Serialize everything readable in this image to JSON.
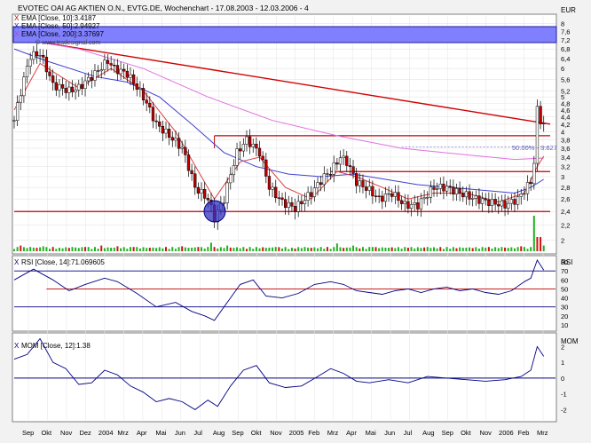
{
  "header": {
    "title": "EVOTEC OAI AG AKTIEN O.N., EVTG.DE, Wochenchart - 17.08.2003 - 12.03.2006 - 4",
    "currency": "EUR"
  },
  "legend": {
    "ema10": "EMA [Close, 10]:3.4187",
    "ema50": "EMA [Close, 50]:2.94927",
    "ema200": "EMA [Close, 200]:3.37697",
    "watermark": "© www.tradesignal.com"
  },
  "annotations": {
    "fib": "50.00% - 3.627"
  },
  "rsi_panel": {
    "label": "RSI [Close, 14]:71.069605",
    "unit": "RSI"
  },
  "mom_panel": {
    "label": "MOM [Close, 12]:1.38",
    "unit": "MOM"
  },
  "colors": {
    "up_candle": "#ffffff",
    "down_candle": "#c00000",
    "ema10": "#d84040",
    "ema50": "#4040d0",
    "ema200": "#e070e0",
    "trendline": "#d00000",
    "level": "#c00000",
    "volume_up": "#20b020",
    "volume_down": "#d01010",
    "indicator": "#000080",
    "legend_box": "#8080ff"
  },
  "chart_data": [
    {
      "type": "candlestick",
      "title": "EVOTEC OAI AG AKTIEN O.N., EVTG.DE, Wochenchart - 17.08.2003 - 12.03.2006 - 4",
      "ylabel": "EUR",
      "yscale": "log",
      "ylim": [
        1.85,
        8.4
      ],
      "yticks": [
        2,
        2.2,
        2.4,
        2.6,
        2.8,
        3,
        3.2,
        3.4,
        3.6,
        3.8,
        4,
        4.2,
        4.4,
        4.6,
        4.8,
        5,
        5.2,
        5.6,
        6,
        6.4,
        6.8,
        7.2,
        7.6,
        8
      ],
      "xticks": [
        "Sep",
        "Okt",
        "Nov",
        "Dez",
        "2004",
        "Mrz",
        "Apr",
        "Mai",
        "Jun",
        "Jul",
        "Aug",
        "Sep",
        "Okt",
        "Nov",
        "2005",
        "Feb",
        "Mrz",
        "Apr",
        "Mai",
        "Jun",
        "Jul",
        "Aug",
        "Sep",
        "Okt",
        "Nov",
        "2006",
        "Feb",
        "Mrz"
      ],
      "close_anchors": [
        [
          0,
          4.3
        ],
        [
          3,
          5.6
        ],
        [
          5,
          6.5
        ],
        [
          8,
          6.6
        ],
        [
          12,
          5.4
        ],
        [
          17,
          5.2
        ],
        [
          20,
          5.3
        ],
        [
          25,
          5.8
        ],
        [
          29,
          6.3
        ],
        [
          31,
          6.0
        ],
        [
          35,
          5.8
        ],
        [
          40,
          5.0
        ],
        [
          44,
          4.2
        ],
        [
          48,
          3.9
        ],
        [
          52,
          3.6
        ],
        [
          56,
          2.8
        ],
        [
          60,
          2.6
        ],
        [
          62,
          2.3
        ],
        [
          65,
          2.6
        ],
        [
          69,
          3.5
        ],
        [
          72,
          3.8
        ],
        [
          76,
          3.5
        ],
        [
          79,
          2.8
        ],
        [
          83,
          2.55
        ],
        [
          87,
          2.45
        ],
        [
          92,
          2.7
        ],
        [
          96,
          3.0
        ],
        [
          98,
          3.1
        ],
        [
          101,
          3.4
        ],
        [
          103,
          3.3
        ],
        [
          106,
          2.9
        ],
        [
          110,
          2.75
        ],
        [
          113,
          2.6
        ],
        [
          117,
          2.7
        ],
        [
          121,
          2.5
        ],
        [
          125,
          2.5
        ],
        [
          130,
          2.8
        ],
        [
          134,
          2.8
        ],
        [
          138,
          2.7
        ],
        [
          143,
          2.6
        ],
        [
          147,
          2.55
        ],
        [
          152,
          2.5
        ],
        [
          156,
          2.6
        ],
        [
          158,
          2.75
        ],
        [
          160,
          2.9
        ],
        [
          161,
          3.3
        ],
        [
          162,
          4.6
        ],
        [
          163,
          4.3
        ],
        [
          164,
          4.2
        ]
      ],
      "ema10": [
        [
          0,
          4.6
        ],
        [
          8,
          6.2
        ],
        [
          20,
          5.3
        ],
        [
          30,
          6.0
        ],
        [
          40,
          5.2
        ],
        [
          50,
          4.0
        ],
        [
          58,
          3.0
        ],
        [
          62,
          2.6
        ],
        [
          70,
          3.3
        ],
        [
          76,
          3.4
        ],
        [
          84,
          2.8
        ],
        [
          92,
          2.6
        ],
        [
          100,
          3.1
        ],
        [
          106,
          3.0
        ],
        [
          114,
          2.8
        ],
        [
          122,
          2.6
        ],
        [
          130,
          2.7
        ],
        [
          140,
          2.7
        ],
        [
          150,
          2.55
        ],
        [
          158,
          2.7
        ],
        [
          162,
          3.2
        ],
        [
          164,
          3.42
        ]
      ],
      "ema50": [
        [
          0,
          6.8
        ],
        [
          10,
          6.3
        ],
        [
          25,
          5.7
        ],
        [
          35,
          5.5
        ],
        [
          45,
          5.0
        ],
        [
          55,
          4.2
        ],
        [
          65,
          3.5
        ],
        [
          75,
          3.2
        ],
        [
          85,
          3.05
        ],
        [
          95,
          3.0
        ],
        [
          105,
          3.05
        ],
        [
          115,
          2.95
        ],
        [
          125,
          2.85
        ],
        [
          135,
          2.8
        ],
        [
          145,
          2.75
        ],
        [
          155,
          2.7
        ],
        [
          160,
          2.8
        ],
        [
          164,
          2.95
        ]
      ],
      "ema200": [
        [
          0,
          7.3
        ],
        [
          20,
          6.8
        ],
        [
          40,
          6.0
        ],
        [
          60,
          5.0
        ],
        [
          80,
          4.3
        ],
        [
          100,
          3.9
        ],
        [
          120,
          3.6
        ],
        [
          140,
          3.45
        ],
        [
          155,
          3.35
        ],
        [
          164,
          3.38
        ]
      ],
      "trendline": [
        [
          0,
          7.3
        ],
        [
          166,
          4.2
        ]
      ],
      "horizontal_levels": [
        {
          "y": 2.4,
          "from": 0,
          "to": 166
        },
        {
          "y": 3.9,
          "from": 62,
          "to": 166
        },
        {
          "y": 3.1,
          "from": 98,
          "to": 166
        }
      ],
      "fib_level": 3.627,
      "volume": [
        [
          2,
          0.4
        ],
        [
          5,
          0.3
        ],
        [
          9,
          0.35
        ],
        [
          14,
          0.25
        ],
        [
          18,
          0.3
        ],
        [
          22,
          0.3
        ],
        [
          27,
          0.4
        ],
        [
          32,
          0.35
        ],
        [
          37,
          0.3
        ],
        [
          42,
          0.25
        ],
        [
          47,
          0.3
        ],
        [
          52,
          0.35
        ],
        [
          57,
          0.3
        ],
        [
          61,
          0.6
        ],
        [
          66,
          0.4
        ],
        [
          71,
          0.3
        ],
        [
          75,
          0.3
        ],
        [
          81,
          0.3
        ],
        [
          86,
          0.25
        ],
        [
          90,
          0.3
        ],
        [
          95,
          0.3
        ],
        [
          100,
          0.55
        ],
        [
          105,
          0.4
        ],
        [
          111,
          0.3
        ],
        [
          116,
          0.25
        ],
        [
          122,
          0.25
        ],
        [
          128,
          0.3
        ],
        [
          134,
          0.3
        ],
        [
          140,
          0.25
        ],
        [
          146,
          0.25
        ],
        [
          151,
          0.3
        ],
        [
          157,
          0.35
        ],
        [
          161,
          2.5
        ],
        [
          162,
          1.0
        ],
        [
          163,
          1.0
        ],
        [
          164,
          0.4
        ]
      ]
    },
    {
      "type": "line",
      "title": "RSI [Close, 14]:71.069605",
      "ylabel": "RSI",
      "ylim": [
        5,
        85
      ],
      "yticks": [
        10,
        20,
        30,
        40,
        50,
        60,
        70,
        80
      ],
      "levels": [
        70,
        50,
        30
      ],
      "values": [
        [
          0,
          60
        ],
        [
          6,
          72
        ],
        [
          12,
          60
        ],
        [
          17,
          48
        ],
        [
          22,
          55
        ],
        [
          28,
          62
        ],
        [
          32,
          58
        ],
        [
          38,
          45
        ],
        [
          44,
          30
        ],
        [
          50,
          35
        ],
        [
          55,
          25
        ],
        [
          59,
          20
        ],
        [
          62,
          15
        ],
        [
          66,
          35
        ],
        [
          70,
          55
        ],
        [
          74,
          60
        ],
        [
          78,
          42
        ],
        [
          83,
          40
        ],
        [
          88,
          45
        ],
        [
          93,
          55
        ],
        [
          98,
          58
        ],
        [
          102,
          55
        ],
        [
          106,
          48
        ],
        [
          110,
          46
        ],
        [
          114,
          44
        ],
        [
          118,
          48
        ],
        [
          122,
          50
        ],
        [
          126,
          46
        ],
        [
          130,
          50
        ],
        [
          134,
          52
        ],
        [
          138,
          48
        ],
        [
          142,
          50
        ],
        [
          146,
          46
        ],
        [
          150,
          44
        ],
        [
          154,
          48
        ],
        [
          158,
          58
        ],
        [
          160,
          62
        ],
        [
          162,
          82
        ],
        [
          164,
          71
        ]
      ]
    },
    {
      "type": "line",
      "title": "MOM [Close, 12]:1.38",
      "ylabel": "MOM",
      "ylim": [
        -2.6,
        2.7
      ],
      "yticks": [
        -2,
        -1,
        0,
        1,
        2
      ],
      "levels": [
        0
      ],
      "values": [
        [
          0,
          1.2
        ],
        [
          4,
          1.5
        ],
        [
          8,
          2.5
        ],
        [
          12,
          1.0
        ],
        [
          16,
          0.6
        ],
        [
          20,
          -0.4
        ],
        [
          24,
          -0.3
        ],
        [
          28,
          0.5
        ],
        [
          32,
          0.2
        ],
        [
          36,
          -0.5
        ],
        [
          40,
          -0.9
        ],
        [
          44,
          -1.5
        ],
        [
          48,
          -1.3
        ],
        [
          52,
          -1.5
        ],
        [
          56,
          -2.0
        ],
        [
          60,
          -1.4
        ],
        [
          63,
          -1.8
        ],
        [
          67,
          -0.5
        ],
        [
          71,
          0.5
        ],
        [
          75,
          0.8
        ],
        [
          79,
          -0.3
        ],
        [
          84,
          -0.6
        ],
        [
          89,
          -0.5
        ],
        [
          94,
          0.1
        ],
        [
          98,
          0.6
        ],
        [
          102,
          0.3
        ],
        [
          106,
          -0.2
        ],
        [
          110,
          -0.3
        ],
        [
          116,
          -0.1
        ],
        [
          122,
          -0.3
        ],
        [
          128,
          0.1
        ],
        [
          134,
          0.0
        ],
        [
          140,
          -0.1
        ],
        [
          146,
          -0.2
        ],
        [
          152,
          -0.1
        ],
        [
          157,
          0.1
        ],
        [
          160,
          0.5
        ],
        [
          162,
          2.0
        ],
        [
          164,
          1.38
        ]
      ]
    }
  ]
}
